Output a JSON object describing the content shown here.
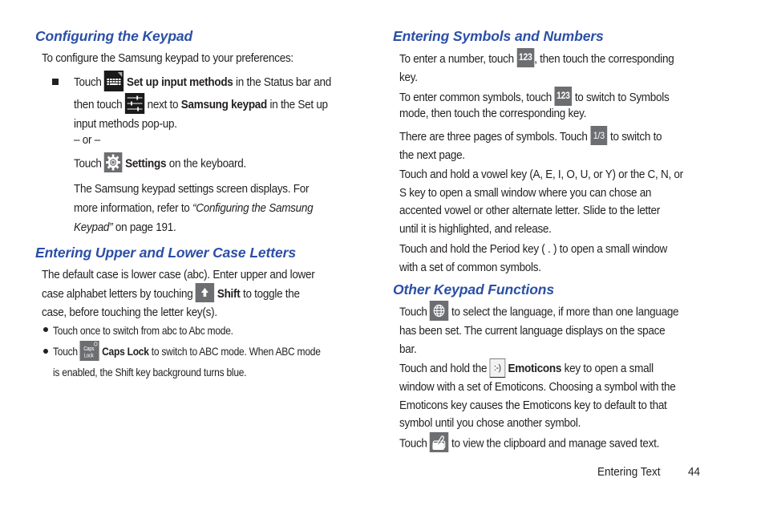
{
  "sections": {
    "configuring_keypad": {
      "heading": "Configuring the Keypad",
      "intro": "To configure the Samsung keypad to your preferences:",
      "step1": {
        "touch": "Touch",
        "set_up_input_methods": "Set up input methods",
        "status_bar_text": " in the Status bar and",
        "then_touch": "then touch",
        "next_to": " next to ",
        "samsung_keypad": "Samsung keypad",
        "in_setup": " in the Set up",
        "popup": "input methods pop-up."
      },
      "or": "– or –",
      "step2": {
        "touch": "Touch",
        "settings": "Settings",
        "on_keyboard": " on the keyboard."
      },
      "result": {
        "line1": "The Samsung keypad settings screen displays. For",
        "line2_a": "more information, refer to ",
        "line2_ref": "“Configuring the Samsung",
        "line3_ref": "Keypad”",
        "line3_b": "  on page 191."
      }
    },
    "upper_lower_case": {
      "heading": "Entering Upper and Lower Case Letters",
      "line1": "The default case is lower case (abc). Enter upper and lower",
      "line2_a": "case alphabet letters by touching ",
      "shift": "Shift",
      "line2_b": " to toggle the",
      "line3": "case, before touching the letter key(s).",
      "bullets": [
        {
          "text": "Touch once to switch from abc to Abc mode."
        },
        {
          "touch": "Touch ",
          "caps_lock": "Caps Lock",
          "text_a": " to switch to ABC mode. When ABC mode",
          "text_b": "is enabled, the Shift key background turns blue."
        }
      ]
    },
    "symbols_numbers": {
      "heading": "Entering Symbols and Numbers",
      "p1_a": "To enter a number, touch ",
      "p1_b": ", then touch the corresponding",
      "p1_c": "key.",
      "p2_a": "To enter common symbols, touch ",
      "p2_b": " to switch to Symbols",
      "p2_c": "mode, then touch the corresponding key.",
      "p3_a": "There are three pages of symbols. Touch ",
      "p3_b": " to switch to",
      "p3_c": "the next page.",
      "p4": [
        "Touch and hold a vowel key (A, E, I, O, U, or Y) or the C, N, or",
        "S key to open a small window where you can chose an",
        "accented vowel or other alternate letter. Slide to the letter",
        "until it is highlighted, and release."
      ],
      "p5": [
        "Touch and hold the Period key ( . ) to open a small window",
        "with a set of common symbols."
      ]
    },
    "other_functions": {
      "heading": "Other Keypad Functions",
      "p1_a": "Touch ",
      "p1_b": " to select the language, if more than one language",
      "p1_c": "has been set. The current language displays on the space",
      "p1_d": "bar.",
      "p2_a": "Touch and hold the ",
      "emoticons": "Emoticons",
      "p2_b": " key to open a small",
      "p2_c": "window with a set of Emoticons. Choosing a symbol with the",
      "p2_d": "Emoticons key causes the Emoticons key to default to that",
      "p2_e": "symbol until you chose another symbol.",
      "p3_a": "Touch ",
      "p3_b": " to view the clipboard and manage saved text."
    }
  },
  "keys": {
    "num_key": "123",
    "page_key": "1/3",
    "emoticon_key": ":-)",
    "caps_line1": "Caps",
    "caps_line2": "Lock"
  },
  "icons": {
    "keyboard": "keyboard-icon",
    "sliders": "settings-sliders-icon",
    "gear": "gear-icon",
    "shift": "shift-arrow-icon",
    "caps_lock": "caps-lock-icon",
    "globe": "globe-icon",
    "clipboard": "clipboard-icon"
  },
  "footer": {
    "section": "Entering Text",
    "page": "44"
  },
  "colors": {
    "heading": "#2b4fa6",
    "body_text": "#231f20",
    "key_gray": "#6d6e71"
  }
}
